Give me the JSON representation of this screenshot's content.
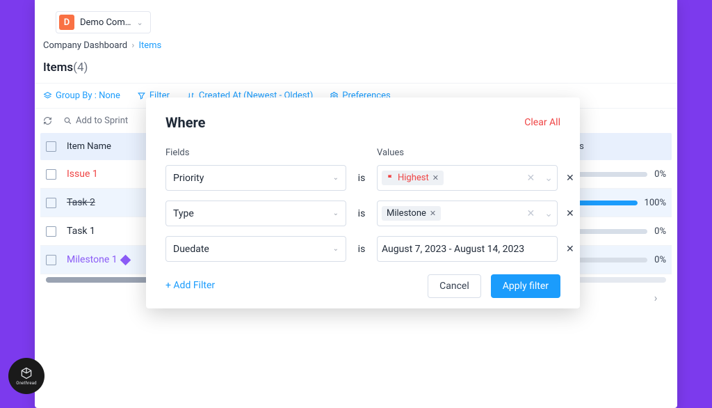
{
  "company": {
    "badge": "D",
    "name": "Demo Com…"
  },
  "breadcrumbs": {
    "root": "Company Dashboard",
    "leaf": "Items"
  },
  "section": {
    "title": "Items",
    "count": "(4)"
  },
  "toolbar": {
    "groupBy": "Group By : None",
    "filter": "Filter",
    "sort": "Created At (Newest - Oldest)",
    "prefs": "Preferences"
  },
  "subbar": {
    "addToSprint": "Add to Sprint"
  },
  "table": {
    "headers": {
      "name": "Item Name",
      "progress": "Progress"
    },
    "rows": [
      {
        "name": "Issue 1",
        "progress": 0,
        "nameClass": "text-red"
      },
      {
        "name": "Task 2",
        "progress": 100,
        "nameClass": "strikethrough"
      },
      {
        "name": "Task 1",
        "progress": 0,
        "nameClass": ""
      },
      {
        "name": "Milestone 1",
        "progress": 0,
        "nameClass": "text-purple",
        "icon": "diamond"
      }
    ]
  },
  "modal": {
    "title": "Where",
    "clearAll": "Clear All",
    "labels": {
      "fields": "Fields",
      "values": "Values",
      "is": "is"
    },
    "filters": [
      {
        "field": "Priority",
        "valueType": "chip",
        "chip": "Highest",
        "chipClass": "chip-red",
        "chipIcon": "flag"
      },
      {
        "field": "Type",
        "valueType": "chip",
        "chip": "Milestone",
        "chipClass": ""
      },
      {
        "field": "Duedate",
        "valueType": "text",
        "text": "August 7, 2023 - August 14, 2023"
      }
    ],
    "addFilter": "+ Add Filter",
    "cancel": "Cancel",
    "apply": "Apply filter"
  },
  "brand": "Onethread"
}
